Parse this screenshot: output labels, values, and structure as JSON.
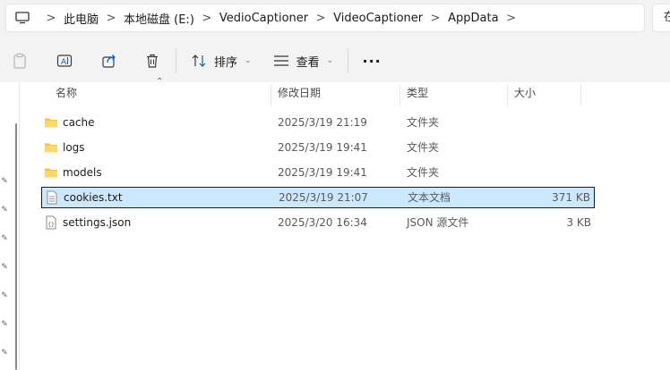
{
  "breadcrumb": {
    "items": [
      "此电脑",
      "本地磁盘 (E:)",
      "VedioCaptioner",
      "VideoCaptioner",
      "AppData"
    ],
    "separator": ">",
    "search_peek": "在"
  },
  "toolbar": {
    "sort_label": "排序",
    "view_label": "查看",
    "more_label": "···"
  },
  "columns": {
    "name": "名称",
    "date": "修改日期",
    "type": "类型",
    "size": "大小"
  },
  "rows": [
    {
      "name": "cache",
      "date": "2025/3/19 21:19",
      "type": "文件夹",
      "size": "",
      "icon": "folder-icon"
    },
    {
      "name": "logs",
      "date": "2025/3/19 19:41",
      "type": "文件夹",
      "size": "",
      "icon": "folder-icon"
    },
    {
      "name": "models",
      "date": "2025/3/19 19:41",
      "type": "文件夹",
      "size": "",
      "icon": "folder-icon"
    },
    {
      "name": "cookies.txt",
      "date": "2025/3/19 21:07",
      "type": "文本文档",
      "size": "371 KB",
      "icon": "text-file-icon",
      "selected": true
    },
    {
      "name": "settings.json",
      "date": "2025/3/20 16:34",
      "type": "JSON 源文件",
      "size": "3 KB",
      "icon": "json-file-icon"
    }
  ],
  "colors": {
    "selection": "#cce8ff",
    "folder": "#f8c542",
    "accent": "#0067c0"
  }
}
